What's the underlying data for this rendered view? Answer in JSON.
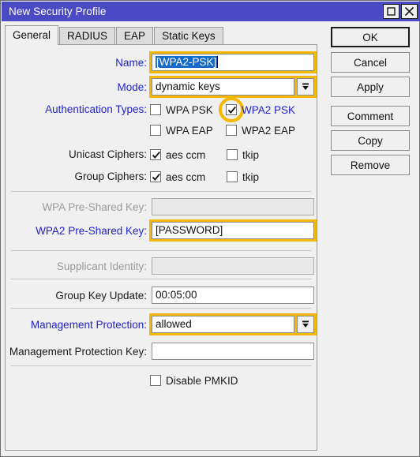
{
  "window": {
    "title": "New Security Profile",
    "titlebar_color": "#4a4ac4",
    "buttons": [
      {
        "name": "maximize-button",
        "icon": "maximize-icon"
      },
      {
        "name": "close-button",
        "icon": "close-icon"
      }
    ]
  },
  "tabs": [
    {
      "label": "General",
      "active": true
    },
    {
      "label": "RADIUS",
      "active": false
    },
    {
      "label": "EAP",
      "active": false
    },
    {
      "label": "Static Keys",
      "active": false
    }
  ],
  "form": {
    "name": {
      "label": "Name:",
      "value": "[WPA2-PSK]",
      "selected": true,
      "highlighted": true
    },
    "mode": {
      "label": "Mode:",
      "value": "dynamic keys",
      "highlighted": true
    },
    "authentication_types": {
      "label": "Authentication Types:",
      "options": [
        {
          "label": "WPA PSK",
          "checked": false,
          "highlighted": false
        },
        {
          "label": "WPA2 PSK",
          "checked": true,
          "highlighted": true
        },
        {
          "label": "WPA EAP",
          "checked": false,
          "highlighted": false
        },
        {
          "label": "WPA2 EAP",
          "checked": false,
          "highlighted": false
        }
      ]
    },
    "unicast_ciphers": {
      "label": "Unicast Ciphers:",
      "options": [
        {
          "label": "aes ccm",
          "checked": true
        },
        {
          "label": "tkip",
          "checked": false
        }
      ]
    },
    "group_ciphers": {
      "label": "Group Ciphers:",
      "options": [
        {
          "label": "aes ccm",
          "checked": true
        },
        {
          "label": "tkip",
          "checked": false
        }
      ]
    },
    "wpa_psk": {
      "label": "WPA Pre-Shared Key:",
      "value": "",
      "disabled": true
    },
    "wpa2_psk": {
      "label": "WPA2 Pre-Shared Key:",
      "value": "[PASSWORD]",
      "highlighted": true
    },
    "supplicant_identity": {
      "label": "Supplicant Identity:",
      "value": "",
      "disabled": true
    },
    "group_key_update": {
      "label": "Group Key Update:",
      "value": "00:05:00"
    },
    "management_protection": {
      "label": "Management Protection:",
      "value": "allowed",
      "highlighted": true
    },
    "management_protection_key": {
      "label": "Management Protection Key:",
      "value": ""
    },
    "disable_pmkid": {
      "label": "Disable PMKID",
      "checked": false
    }
  },
  "actions": [
    {
      "label": "OK",
      "default": true
    },
    {
      "label": "Cancel",
      "default": false
    },
    {
      "label": "Apply",
      "default": false
    },
    {
      "label": "Comment",
      "default": false
    },
    {
      "label": "Copy",
      "default": false
    },
    {
      "label": "Remove",
      "default": false
    }
  ],
  "colors": {
    "highlight_gold": "#f5b800",
    "highlight_label": "#2222cc",
    "selection_blue": "#1569c7",
    "titlebar": "#4a4ac4"
  }
}
